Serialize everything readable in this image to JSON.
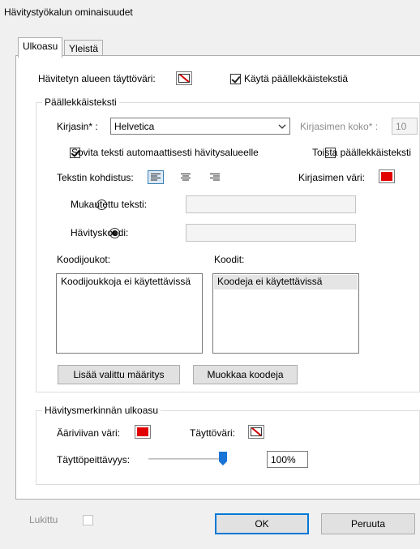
{
  "window": {
    "title": "Hävitystyökalun ominaisuudet"
  },
  "tabs": [
    {
      "label": "Ulkoasu",
      "active": true
    },
    {
      "label": "Yleistä",
      "active": false
    }
  ],
  "appearance": {
    "fill_color_label": "Hävitetyn alueen täyttöväri:",
    "fill_color": "none",
    "use_overlay_label": "Käytä päällekkäistekstiä",
    "use_overlay_checked": true
  },
  "overlay": {
    "group_title": "Päällekkäisteksti",
    "font_label": "Kirjasin* :",
    "font_value": "Helvetica",
    "font_size_label": "Kirjasimen koko* :",
    "font_size_value": "10",
    "autofit_label": "Sovita teksti automaattisesti hävitysalueelle",
    "autofit_checked": true,
    "repeat_label": "Toista päällekkäisteksti",
    "repeat_checked": false,
    "alignment_label": "Tekstin kohdistus:",
    "alignment_selected": "left",
    "font_color_label": "Kirjasimen väri:",
    "font_color": "#e00000",
    "custom_text_label": "Mukautettu teksti:",
    "custom_text_value": "",
    "redaction_code_label": "Hävityskoodi:",
    "redaction_code_value": "",
    "selected_option": "redaction_code",
    "code_sets_label": "Koodijoukot:",
    "code_sets_items": [
      "Koodijoukkoja ei käytettävissä"
    ],
    "codes_label": "Koodit:",
    "codes_items": [
      "Koodeja ei käytettävissä"
    ],
    "add_entry_button": "Lisää valittu määritys",
    "edit_codes_button": "Muokkaa koodeja"
  },
  "mark_appearance": {
    "group_title": "Hävitysmerkinnän ulkoasu",
    "outline_color_label": "Ääriviivan väri:",
    "outline_color": "#e00000",
    "fill_color_label": "Täyttöväri:",
    "fill_color": "none",
    "opacity_label": "Täyttöpeittävyys:",
    "opacity_value": "100%",
    "opacity_fraction": 1.0
  },
  "footer": {
    "locked_label": "Lukittu",
    "locked_checked": false,
    "ok_button": "OK",
    "cancel_button": "Peruuta"
  },
  "colors": {
    "accent": "#0078d7",
    "red": "#e00000",
    "selected_align": "#3c7fb1",
    "slider_thumb": "#1a73d6"
  }
}
